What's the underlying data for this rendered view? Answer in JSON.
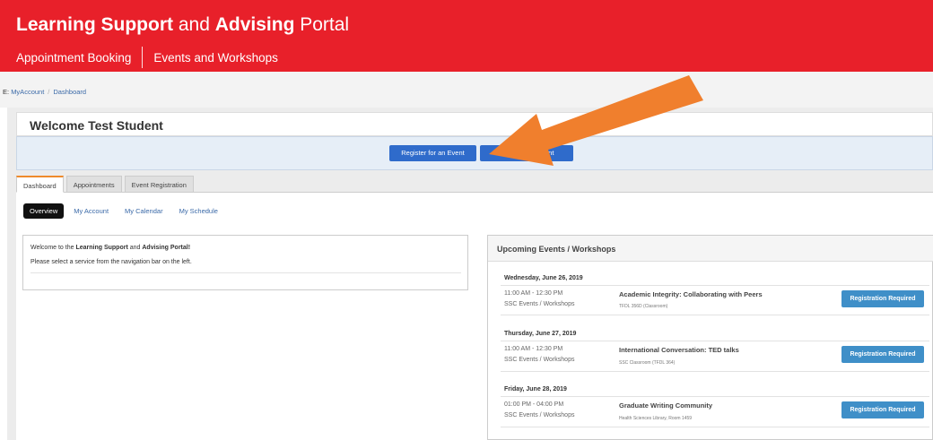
{
  "header": {
    "title_bold_1": "Learning Support",
    "title_mid": " and ",
    "title_bold_2": "Advising",
    "title_end": " Portal",
    "nav": [
      "Appointment Booking",
      "Events and Workshops"
    ]
  },
  "breadcrumb": {
    "prefix": "E:",
    "items": [
      "MyAccount",
      "Dashboard"
    ],
    "separator": "/"
  },
  "welcome": {
    "title": "Welcome Test Student"
  },
  "actions": {
    "register_label": "Register for an Event",
    "book_label": "Book Appointment"
  },
  "tabs": [
    "Dashboard",
    "Appointments",
    "Event Registration"
  ],
  "subnav": [
    "Overview",
    "My Account",
    "My Calendar",
    "My Schedule"
  ],
  "intro": {
    "line1_a": "Welcome to the ",
    "line1_b": "Learning Support",
    "line1_c": " and ",
    "line1_d": "Advising Portal!",
    "line2": "Please select a service from the navigation bar on the left."
  },
  "events": {
    "title": "Upcoming Events / Workshops",
    "register_required": "Registration Required",
    "days": [
      {
        "date": "Wednesday, June 26, 2019",
        "time": "11:00 AM - 12:30 PM",
        "category": "SSC Events / Workshops",
        "name": "Academic Integrity: Collaborating with Peers",
        "location": "TFDL 356D (Classroom)"
      },
      {
        "date": "Thursday, June 27, 2019",
        "time": "11:00 AM - 12:30 PM",
        "category": "SSC Events / Workshops",
        "name": "International Conversation: TED talks",
        "location": "SSC Classroom (TFDL 364)"
      },
      {
        "date": "Friday, June 28, 2019",
        "time": "01:00 PM - 04:00 PM",
        "category": "SSC Events / Workshops",
        "name": "Graduate Writing Community",
        "location": "Health Sciences Library, Room 1459"
      }
    ]
  },
  "colors": {
    "brand_red": "#e8202a",
    "button_blue": "#2f6bcb",
    "register_blue": "#3f8fc8",
    "arrow_orange": "#f07f2d",
    "tab_accent": "#ef8a2b"
  }
}
